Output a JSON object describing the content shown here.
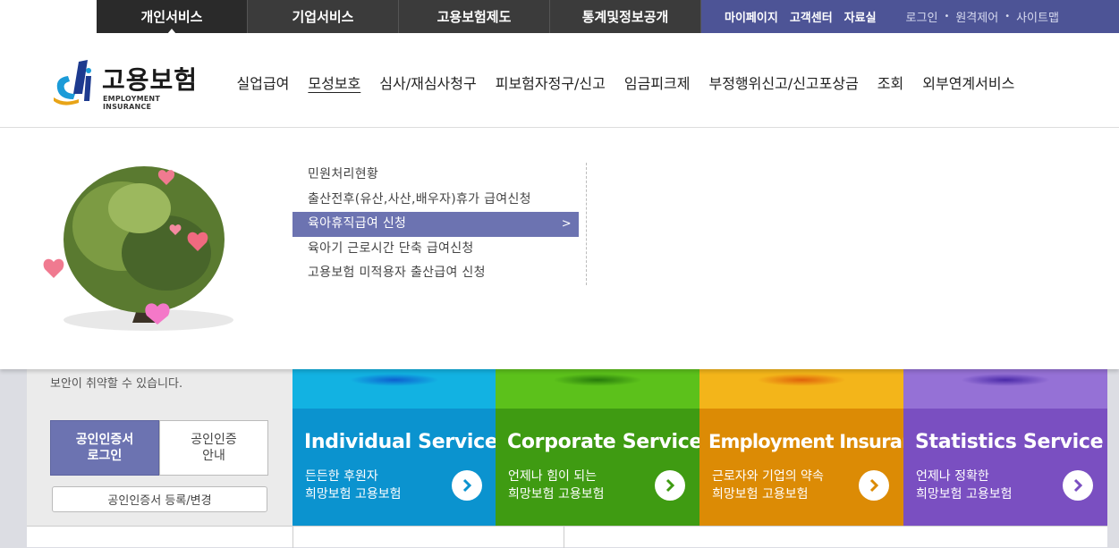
{
  "topnav": {
    "tabs": [
      {
        "label": "개인서비스",
        "active": true
      },
      {
        "label": "기업서비스",
        "active": false
      },
      {
        "label": "고용보험제도",
        "active": false
      },
      {
        "label": "통계및정보공개",
        "active": false
      }
    ],
    "util_links": [
      "마이페이지",
      "고객센터",
      "자료실"
    ],
    "util_small": [
      "로그인",
      "원격제어",
      "사이트맵"
    ]
  },
  "logo": {
    "text_ko": "고용보험",
    "text_en": "EMPLOYMENT INSURANCE"
  },
  "gnb": {
    "items": [
      "실업급여",
      "모성보호",
      "심사/재심사청구",
      "피보험자정구/신고",
      "임금피크제",
      "부정행위신고/신고포상금",
      "조회",
      "외부연계서비스"
    ],
    "active": "모성보호"
  },
  "submenu": {
    "items": [
      "민원처리현황",
      "출산전후(유산,사산,배우자)휴가 급여신청",
      "육아휴직급여 신청",
      "육아기 근로시간 단축 급여신청",
      "고용보험 미적용자 출산급여 신청"
    ],
    "selected_index": 2
  },
  "left_panel": {
    "note": "보안이 취약할 수 있습니다.",
    "cert_login": [
      "공인인증서",
      "로그인"
    ],
    "cert_guide": [
      "공인인증",
      "안내"
    ],
    "cert_register": "공인인증서 등록/변경"
  },
  "services": [
    {
      "title": "Individual Service",
      "line1": "든든한 후원자",
      "line2": "희망보험 고용보험",
      "color": "#0b93cf",
      "band": "#12b2e2",
      "arrow_color": "#0b93cf"
    },
    {
      "title": "Corporate Service",
      "line1": "언제나 힘이 되는",
      "line2": "희망보험 고용보험",
      "color": "#3f9b12",
      "band": "#5cc11b",
      "arrow_color": "#3f9b12"
    },
    {
      "title": "Employment Insurance",
      "line1": "근로자와 기업의 약속",
      "line2": "희망보험 고용보험",
      "color": "#dc8b05",
      "band": "#f3b51a",
      "arrow_color": "#dc8b05"
    },
    {
      "title": "Statistics Service",
      "line1": "언제나 정확한",
      "line2": "희망보험 고용보험",
      "color": "#7a4fc1",
      "band": "#9571d6",
      "arrow_color": "#7a4fc1"
    }
  ]
}
